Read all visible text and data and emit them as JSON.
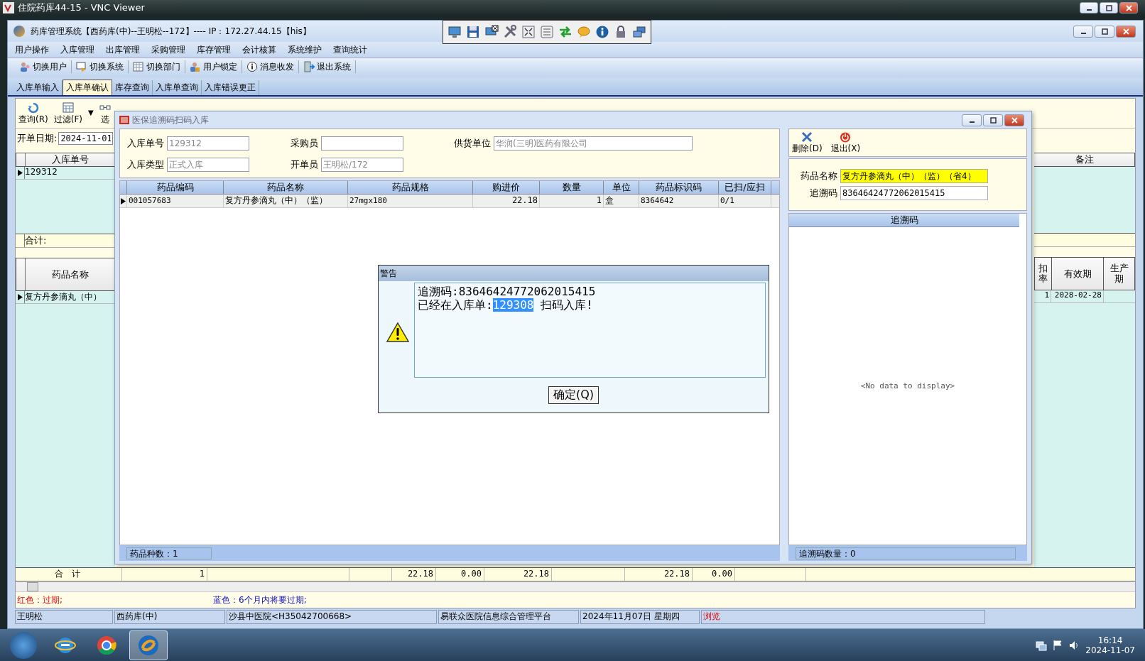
{
  "vnc_window": {
    "title": "住院药库44-15 - VNC Viewer"
  },
  "app_window": {
    "title": "药库管理系统【西药库(中)--王明松--172】---- IP：172.27.44.15【his】"
  },
  "menu": [
    "用户操作",
    "入库管理",
    "出库管理",
    "采购管理",
    "库存管理",
    "会计核算",
    "系统维护",
    "查询统计"
  ],
  "toolbar": [
    {
      "kind": "user",
      "label": "切换用户"
    },
    {
      "kind": "system",
      "label": "切换系统"
    },
    {
      "kind": "dept",
      "label": "切换部门"
    },
    {
      "kind": "lock",
      "label": "用户锁定"
    },
    {
      "kind": "info",
      "label": "消息收发"
    },
    {
      "kind": "exit",
      "label": "退出系统"
    }
  ],
  "tabs": [
    {
      "label": "入库单输入",
      "selected": false
    },
    {
      "label": "入库单确认",
      "selected": true
    },
    {
      "label": "库存查询",
      "selected": false
    },
    {
      "label": "入库单查询",
      "selected": false
    },
    {
      "label": "入库错误更正",
      "selected": false
    }
  ],
  "page_toolbar": [
    {
      "kind": "refresh",
      "label": "查询(R)"
    },
    {
      "kind": "filter",
      "label": "过滤(F)"
    },
    {
      "kind": "dropdown",
      "label": "▼"
    },
    {
      "kind": "select",
      "label": "选"
    }
  ],
  "order_date": {
    "label": "开单日期:",
    "value": "2024-11-01"
  },
  "order_grid": {
    "columns": [
      "入库单号"
    ],
    "rows": [
      {
        "current": true,
        "cells": [
          "129312"
        ]
      }
    ],
    "total_label": "合计:"
  },
  "detail_grid": {
    "columns": [
      "药品名称"
    ],
    "rows": [
      {
        "current": true,
        "cells": [
          "复方丹参滴丸（中）"
        ]
      }
    ]
  },
  "right_grid": {
    "upper_column": "备注",
    "lower_columns": [
      "扣率",
      "有效期",
      "生产期"
    ],
    "lower_row": [
      "1",
      "2028-02-28"
    ]
  },
  "totals": {
    "label": "合　计",
    "values": [
      "1",
      "22.18",
      "0.00",
      "22.18",
      "22.18",
      "0.00"
    ]
  },
  "legend": [
    {
      "text": "红色：过期;",
      "kind": "expired"
    },
    {
      "text": "蓝色：6个月内将要过期;",
      "kind": "expiring"
    }
  ],
  "status_bar": [
    {
      "text": "王明松",
      "alert": false
    },
    {
      "text": "西药库(中)",
      "alert": false
    },
    {
      "text": "沙县中医院<H35042700668>",
      "alert": false
    },
    {
      "text": "易联众医院信息综合管理平台",
      "alert": false
    },
    {
      "text": "2024年11月07日 星期四",
      "alert": false
    },
    {
      "text": "浏览",
      "alert": true
    }
  ],
  "taskbar": {
    "apps": [
      {
        "kind": "ie",
        "selected": false
      },
      {
        "kind": "chrome",
        "selected": false
      },
      {
        "kind": "app",
        "selected": true
      }
    ],
    "time": "16:14",
    "date": "2024-11-07"
  },
  "scan_window": {
    "title": "医保追溯码扫码入库",
    "fields": [
      {
        "label": "入库单号",
        "value": "129312",
        "disabled": true
      },
      {
        "label": "采购员"
      },
      {
        "label": "供货单位",
        "value": "华润(三明)医药有限公司",
        "disabled": true
      },
      {
        "label": "入库类型",
        "value": "正式入库",
        "disabled": true
      },
      {
        "label": "开单员",
        "value": "王明松/172",
        "disabled": true
      }
    ],
    "grid": {
      "columns": [
        "药品编码",
        "药品名称",
        "药品规格",
        "购进价",
        "数量",
        "单位",
        "药品标识码",
        "已扫/应扫"
      ],
      "rows": [
        {
          "current": true,
          "cells": [
            "001057683",
            "复方丹参滴丸（中）（监）",
            "27mgx180",
            "22.18",
            "1",
            "盒",
            "8364642",
            "0/1"
          ]
        }
      ]
    },
    "footer": "药品种数：1",
    "side_toolbar": [
      {
        "kind": "delete",
        "label": "删除(D)"
      },
      {
        "kind": "exit",
        "label": "退出(X)"
      }
    ],
    "drug_name": {
      "label": "药品名称",
      "value": "复方丹参滴丸（中）（监）（省4）"
    },
    "trace_code": {
      "label": "追溯码",
      "value": "83646424772062015415"
    },
    "side_column": "追溯码",
    "empty_text": "<No data to display>",
    "side_footer": "追溯码数量：0"
  },
  "alert": {
    "title": "警告",
    "line1": "追溯码:83646424772062015415",
    "line2_before": "已经在入库单:",
    "line2_selected": "129308",
    "line2_after": " 扫码入库!",
    "button": "确定(Q)"
  }
}
